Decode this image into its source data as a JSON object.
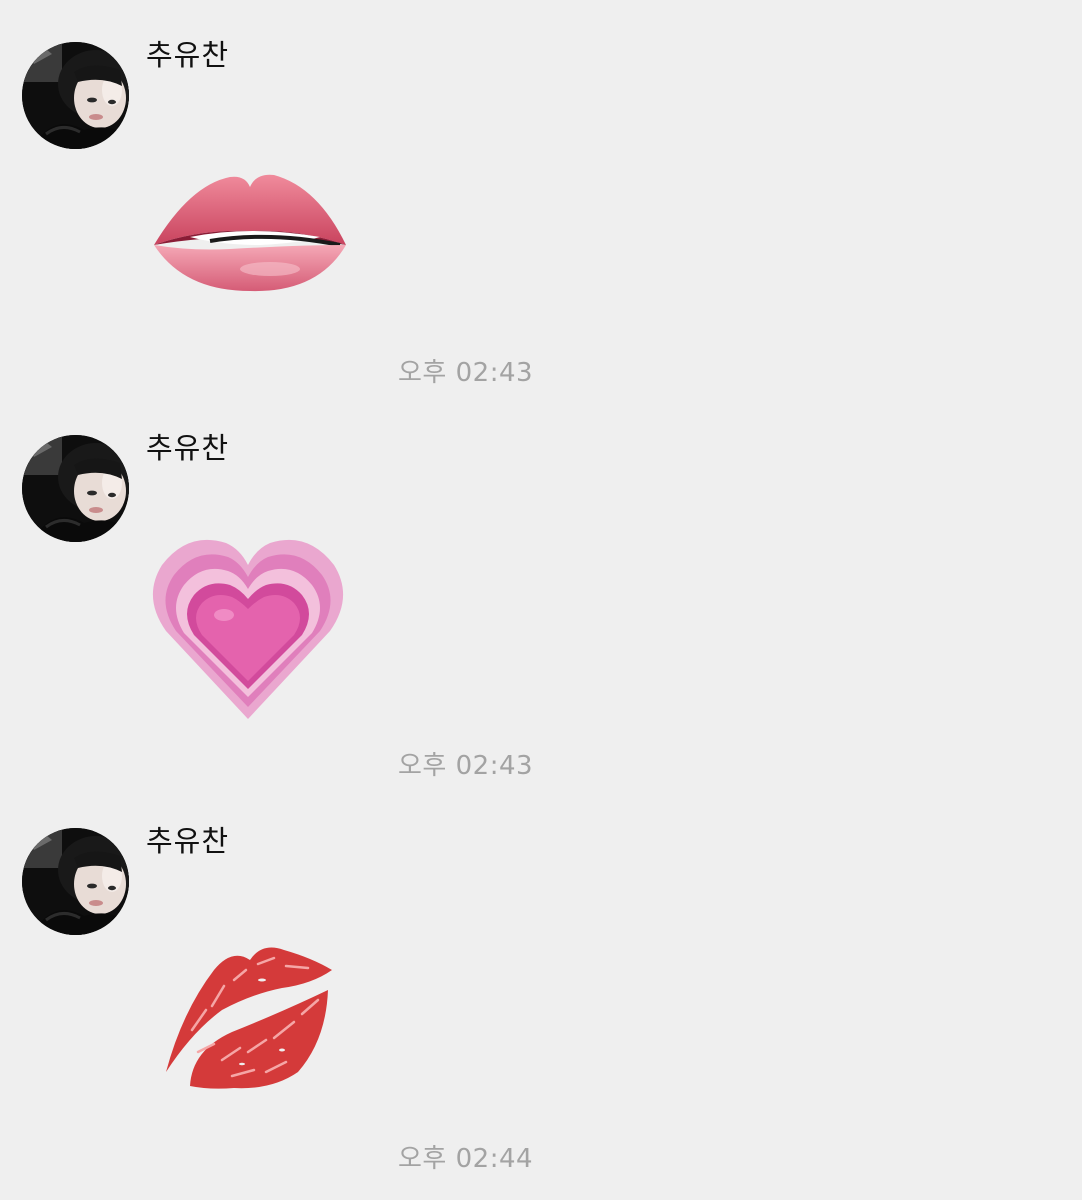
{
  "messages": [
    {
      "sender": "추유찬",
      "avatar_icon": "profile-photo",
      "content_emoji": "biting-lip-emoji",
      "time": "오후 02:43"
    },
    {
      "sender": "추유찬",
      "avatar_icon": "profile-photo",
      "content_emoji": "growing-heart-emoji",
      "time": "오후 02:43"
    },
    {
      "sender": "추유찬",
      "avatar_icon": "profile-photo",
      "content_emoji": "kiss-mark-emoji",
      "time": "오후 02:44"
    }
  ],
  "colors": {
    "background": "#efefef",
    "sender_text": "#111111",
    "timestamp_text": "#a3a3a3"
  }
}
